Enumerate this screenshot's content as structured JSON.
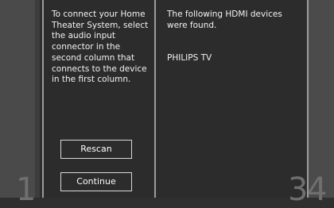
{
  "columns": {
    "instruction": "To connect your Home Theater System, select the audio input connector in the second column that connects to the device in the first column.",
    "found_message": "The following HDMI devices were found.",
    "devices": [
      "PHILIPS TV"
    ]
  },
  "buttons": {
    "rescan": "Rescan",
    "continue": "Continue"
  },
  "steps": {
    "left": "1",
    "right_a": "3",
    "right_b": "4"
  }
}
